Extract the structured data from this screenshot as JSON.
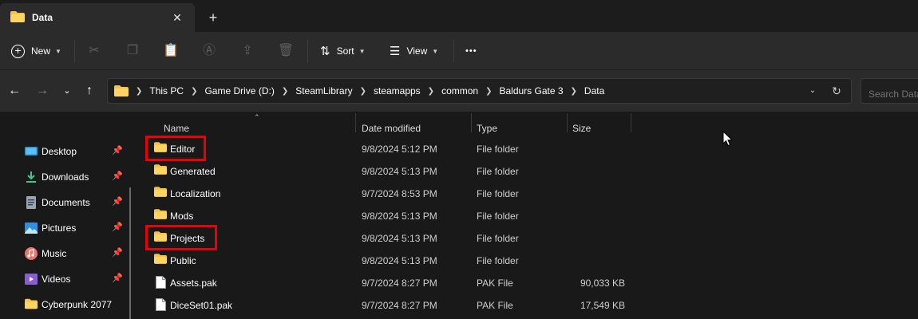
{
  "tab": {
    "title": "Data",
    "close_glyph": "✕",
    "new_glyph": "+"
  },
  "commands": {
    "new_label": "New",
    "sort_label": "Sort",
    "view_label": "View",
    "more_glyph": "•••"
  },
  "address": {
    "crumbs": [
      "This PC",
      "Game Drive (D:)",
      "SteamLibrary",
      "steamapps",
      "common",
      "Baldurs Gate 3",
      "Data"
    ],
    "search_placeholder": "Search Data"
  },
  "sidebar": {
    "items": [
      {
        "label": "Desktop",
        "icon": "desktop-icon",
        "pinned": true
      },
      {
        "label": "Downloads",
        "icon": "download-icon",
        "pinned": true
      },
      {
        "label": "Documents",
        "icon": "document-icon",
        "pinned": true
      },
      {
        "label": "Pictures",
        "icon": "pictures-icon",
        "pinned": true
      },
      {
        "label": "Music",
        "icon": "music-icon",
        "pinned": true
      },
      {
        "label": "Videos",
        "icon": "videos-icon",
        "pinned": true
      },
      {
        "label": "Cyberpunk 2077",
        "icon": "folder-icon",
        "pinned": false
      }
    ]
  },
  "columns": {
    "name": "Name",
    "date": "Date modified",
    "type": "Type",
    "size": "Size"
  },
  "files": [
    {
      "name": "Editor",
      "date": "9/8/2024 5:12 PM",
      "type": "File folder",
      "size": "",
      "kind": "folder",
      "highlighted": true
    },
    {
      "name": "Generated",
      "date": "9/8/2024 5:13 PM",
      "type": "File folder",
      "size": "",
      "kind": "folder",
      "highlighted": false
    },
    {
      "name": "Localization",
      "date": "9/7/2024 8:53 PM",
      "type": "File folder",
      "size": "",
      "kind": "folder",
      "highlighted": false
    },
    {
      "name": "Mods",
      "date": "9/8/2024 5:13 PM",
      "type": "File folder",
      "size": "",
      "kind": "folder",
      "highlighted": false
    },
    {
      "name": "Projects",
      "date": "9/8/2024 5:13 PM",
      "type": "File folder",
      "size": "",
      "kind": "folder",
      "highlighted": true
    },
    {
      "name": "Public",
      "date": "9/8/2024 5:13 PM",
      "type": "File folder",
      "size": "",
      "kind": "folder",
      "highlighted": false
    },
    {
      "name": "Assets.pak",
      "date": "9/7/2024 8:27 PM",
      "type": "PAK File",
      "size": "90,033 KB",
      "kind": "file",
      "highlighted": false
    },
    {
      "name": "DiceSet01.pak",
      "date": "9/7/2024 8:27 PM",
      "type": "PAK File",
      "size": "17,549 KB",
      "kind": "file",
      "highlighted": false
    }
  ],
  "colors": {
    "folder": "#f5c24c",
    "highlight": "#e8000b",
    "accent": "#4cc2ff"
  }
}
